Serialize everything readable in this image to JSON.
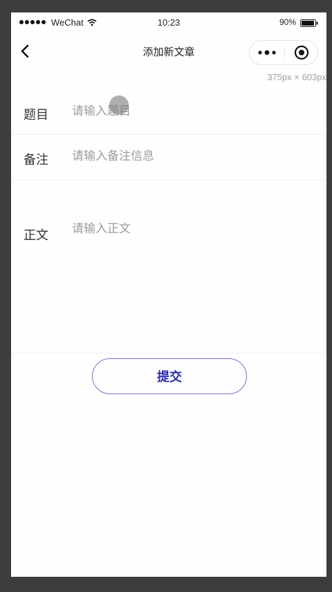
{
  "status_bar": {
    "carrier": "WeChat",
    "time": "10:23",
    "battery": "90%"
  },
  "nav": {
    "title": "添加新文章",
    "more_icon": "more-dots-icon",
    "close_icon": "target-circle-icon",
    "back_icon": "chevron-left-icon"
  },
  "size_tag": "375px × 603px",
  "form": {
    "title": {
      "label": "题目",
      "placeholder": "请输入题目",
      "value": ""
    },
    "note": {
      "label": "备注",
      "placeholder": "请输入备注信息",
      "value": ""
    },
    "body": {
      "label": "正文",
      "placeholder": "请输入正文",
      "value": ""
    }
  },
  "submit_label": "提交",
  "colors": {
    "accent": "#2b2bb2",
    "button_border": "#6f6fd6",
    "placeholder": "#9d9d9d",
    "background": "#fefefe"
  }
}
